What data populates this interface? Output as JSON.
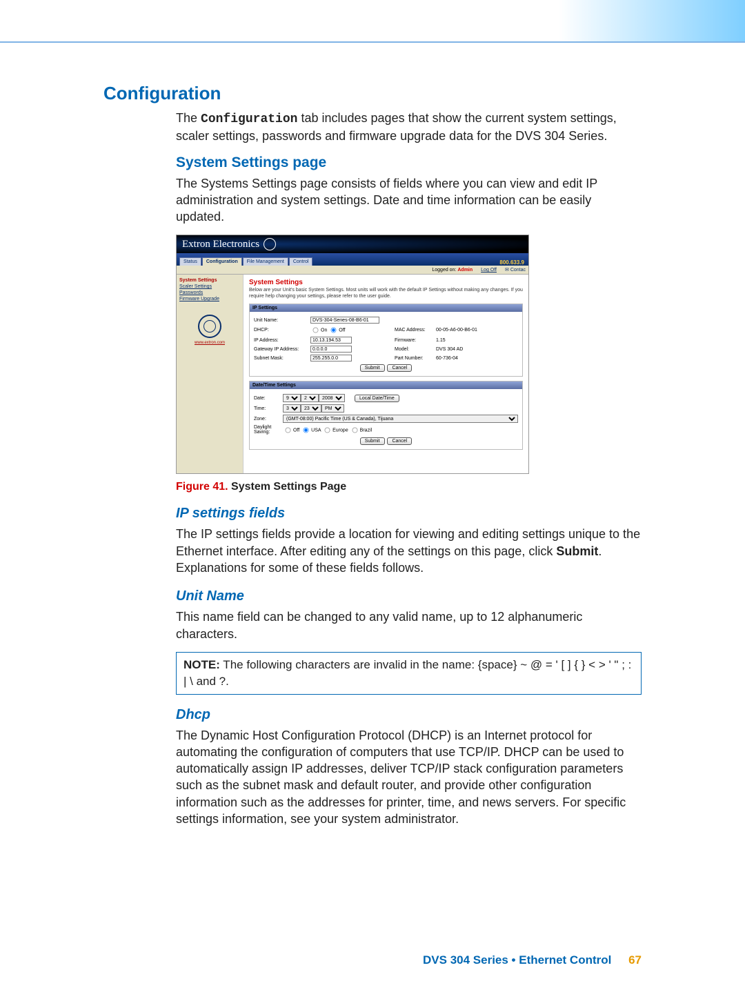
{
  "h1": "Configuration",
  "intro_pre": "The ",
  "intro_bold": "Configuration",
  "intro_post": " tab includes pages that show the current system settings, scaler settings, passwords and firmware upgrade data for the DVS 304 Series.",
  "h2": "System Settings page",
  "p2": "The Systems Settings page consists of fields where you can view and edit IP administration and system settings. Date and time information can be easily updated.",
  "shot": {
    "brand": "Extron Electronics",
    "tabs": {
      "status": "Status",
      "config": "Configuration",
      "file": "File Management",
      "control": "Control"
    },
    "phone": "800.633.9",
    "logged_label": "Logged on:",
    "logged_user": "Admin",
    "logoff": "Log Off",
    "contact": "Contac",
    "side": {
      "s1": "System Settings",
      "s2": "Scaler Settings",
      "s3": "Passwords",
      "s4": "Firmware Upgrade",
      "url": "www.extron.com"
    },
    "main": {
      "title": "System Settings",
      "desc": "Below are your Unit's basic System Settings. Most units will work with the default IP Settings without making any changes. If you require help changing your settings, please refer to the user guide.",
      "ip_header": "IP Settings",
      "unit_name_l": "Unit Name:",
      "unit_name_v": "DVS-304-Series-08-B6-01",
      "dhcp_l": "DHCP:",
      "dhcp_on": "On",
      "dhcp_off": "Off",
      "mac_l": "MAC Address:",
      "mac_v": "00-05-A6-00-B6-01",
      "ip_l": "IP Address:",
      "ip_v": "10.13.194.53",
      "fw_l": "Firmware:",
      "fw_v": "1.15",
      "gw_l": "Gateway IP Address:",
      "gw_v": "0.0.0.0",
      "model_l": "Model:",
      "model_v": "DVS 304 AD",
      "sn_l": "Subnet Mask:",
      "sn_v": "255.255.0.0",
      "pn_l": "Part Number:",
      "pn_v": "60-736-04",
      "submit": "Submit",
      "cancel": "Cancel",
      "dt_header": "Date/Time Settings",
      "date_l": "Date:",
      "date_m": "9",
      "date_d": "2",
      "date_y": "2008",
      "localbtn": "Local Date/Time",
      "time_l": "Time:",
      "time_h": "3",
      "time_m": "23",
      "time_ap": "PM",
      "zone_l": "Zone:",
      "zone_v": "(GMT-08:00) Pacific Time (US & Canada), Tijuana",
      "ds_l": "Daylight Saving:",
      "ds_off": "Off",
      "ds_usa": "USA",
      "ds_eu": "Europe",
      "ds_br": "Brazil"
    }
  },
  "fig_num": "Figure 41. ",
  "fig_txt": "System Settings Page",
  "h3a": "IP settings fields",
  "p3a_a": "The IP settings fields provide a location for viewing and editing settings unique to the Ethernet interface. After editing any of the settings on this page, click ",
  "p3a_b": "Submit",
  "p3a_c": ". Explanations for some of these fields follows.",
  "h3b": "Unit Name",
  "p3b": "This name field can be changed to any valid name, up to 12 alphanumeric characters.",
  "note_label": "NOTE:",
  "note_text": " The following characters are invalid in the name: {space} ~ @ = ' [ ] { } < > ' \" ; : | \\ and ?.",
  "h3c": "Dhcp",
  "p3c": "The Dynamic Host Configuration Protocol (DHCP) is an Internet protocol for automating the configuration of computers that use TCP/IP. DHCP can be used to automatically assign IP addresses, deliver TCP/IP stack configuration parameters such as the subnet mask and default router, and provide other configuration information such as the addresses for printer, time, and news servers. For specific settings information, see your system administrator.",
  "footer_text": "DVS 304 Series • Ethernet Control",
  "page_num": "67"
}
